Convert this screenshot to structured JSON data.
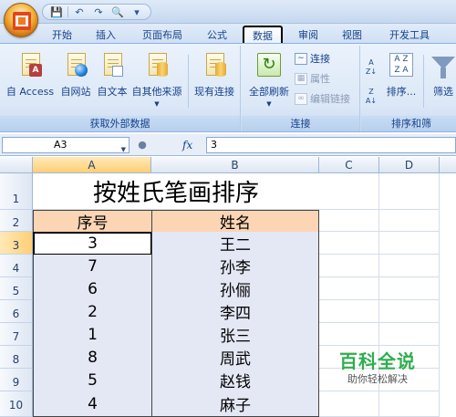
{
  "quick_access": {
    "icons": [
      "save-icon",
      "undo-icon",
      "redo-icon",
      "preview-icon",
      "customize-icon"
    ]
  },
  "tabs": [
    "开始",
    "插入",
    "页面布局",
    "公式",
    "数据",
    "审阅",
    "视图",
    "开发工具"
  ],
  "active_tab": "数据",
  "ribbon": {
    "external_data": {
      "title": "获取外部数据",
      "buttons": [
        "自 Access",
        "自网站",
        "自文本",
        "自其他来源"
      ]
    },
    "existing_connections": "现有连接",
    "connections": {
      "title": "连接",
      "refresh_all": "全部刷新",
      "connections": "连接",
      "properties": "属性",
      "edit_links": "编辑链接"
    },
    "sort_filter": {
      "title": "排序和筛",
      "sort": "排序...",
      "filter": "筛选"
    }
  },
  "formula_bar": {
    "name_box": "A3",
    "fx": "fx",
    "value": "3"
  },
  "sheet": {
    "columns": [
      "A",
      "B",
      "C",
      "D"
    ],
    "rows": [
      "1",
      "2",
      "3",
      "4",
      "5",
      "6",
      "7",
      "8",
      "9",
      "10"
    ],
    "title": "按姓氏笔画排序",
    "headers": {
      "num": "序号",
      "name": "姓名"
    },
    "data": [
      {
        "num": "3",
        "name": "王二"
      },
      {
        "num": "7",
        "name": "孙李"
      },
      {
        "num": "6",
        "name": "孙俪"
      },
      {
        "num": "2",
        "name": "李四"
      },
      {
        "num": "1",
        "name": "张三"
      },
      {
        "num": "8",
        "name": "周武"
      },
      {
        "num": "5",
        "name": "赵钱"
      },
      {
        "num": "4",
        "name": "麻子"
      }
    ]
  },
  "watermark": {
    "main": "百科全说",
    "sub": "助你轻松解决"
  }
}
